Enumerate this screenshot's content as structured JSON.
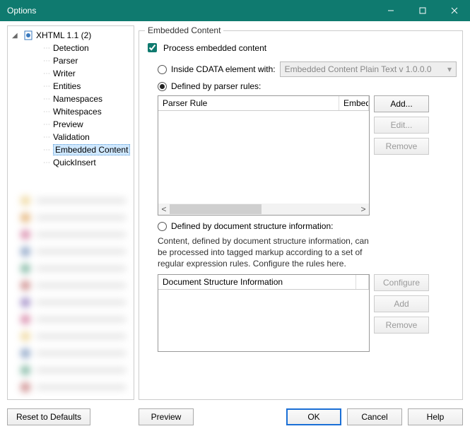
{
  "window": {
    "title": "Options"
  },
  "tree": {
    "root_label": "XHTML 1.1 (2)",
    "items": [
      "Detection",
      "Parser",
      "Writer",
      "Entities",
      "Namespaces",
      "Whitespaces",
      "Preview",
      "Validation",
      "Embedded Content",
      "QuickInsert"
    ],
    "selected_index": 8
  },
  "panel": {
    "legend": "Embedded Content",
    "process_label": "Process embedded content",
    "process_checked": true,
    "opt_cdata_label": "Inside CDATA element with:",
    "cdata_dropdown": "Embedded Content Plain Text v 1.0.0.0",
    "opt_parser_label": "Defined by parser rules:",
    "opt_selected": "parser",
    "parser_table": {
      "col1": "Parser Rule",
      "col2": "Embed"
    },
    "parser_buttons": {
      "add": "Add...",
      "edit": "Edit...",
      "remove": "Remove"
    },
    "opt_doc_label": "Defined by document structure information:",
    "doc_desc": "Content, defined by document structure information, can be processed into tagged markup according to a set of regular expression rules. Configure the rules here.",
    "doc_table": {
      "col1": "Document Structure Information"
    },
    "doc_buttons": {
      "configure": "Configure",
      "add": "Add",
      "remove": "Remove"
    }
  },
  "footer": {
    "reset": "Reset to Defaults",
    "preview": "Preview",
    "ok": "OK",
    "cancel": "Cancel",
    "help": "Help"
  },
  "blur_colors": [
    "#e6c36a",
    "#d68a2e",
    "#c34a7c",
    "#4a6fa5",
    "#3a8f6f",
    "#b04a4a",
    "#6a4aa5",
    "#c34a7c",
    "#e6c36a",
    "#4a6fa5",
    "#3a8f6f",
    "#b04a4a"
  ]
}
